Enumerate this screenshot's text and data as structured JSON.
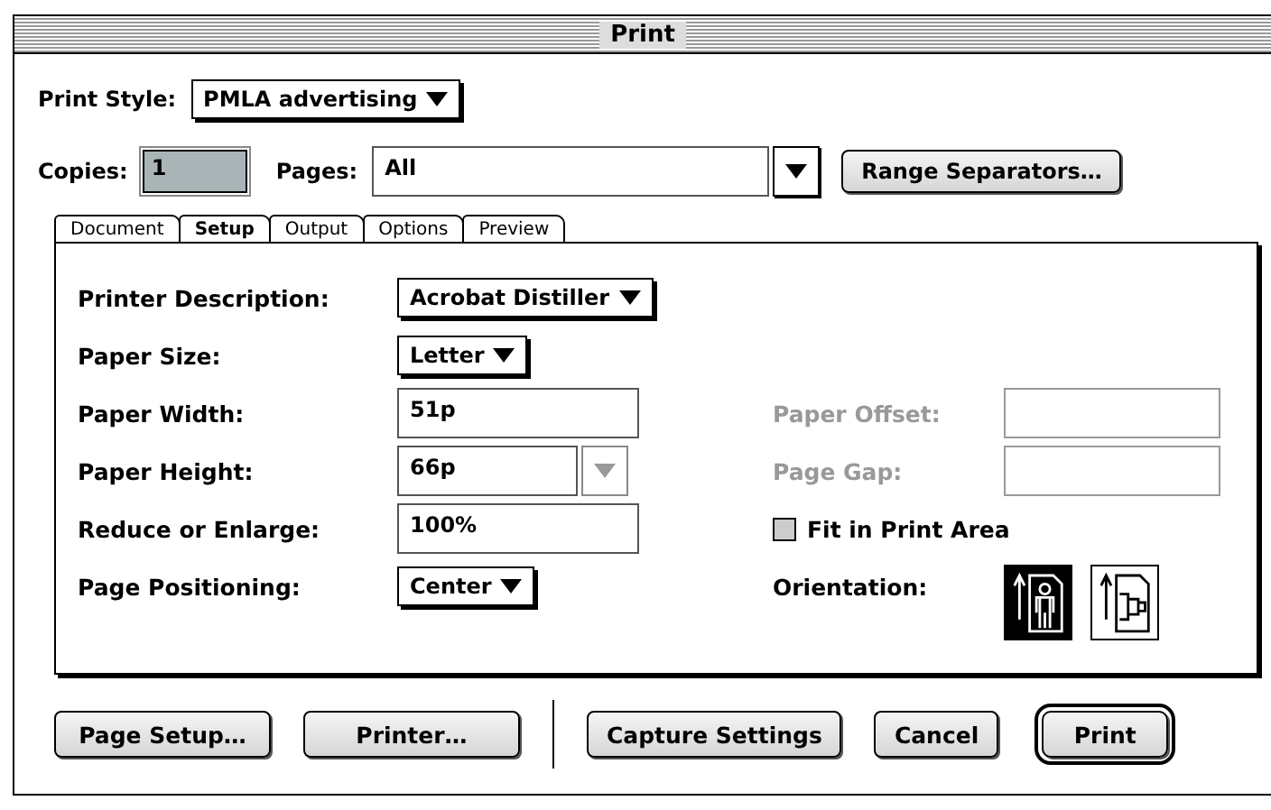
{
  "window": {
    "title": "Print"
  },
  "print_style": {
    "label": "Print Style:",
    "value": "PMLA advertising"
  },
  "copies": {
    "label": "Copies:",
    "value": "1"
  },
  "pages": {
    "label": "Pages:",
    "value": "All"
  },
  "range_button": "Range Separators…",
  "tabs": [
    {
      "label": "Document",
      "selected": false
    },
    {
      "label": "Setup",
      "selected": true
    },
    {
      "label": "Output",
      "selected": false
    },
    {
      "label": "Options",
      "selected": false
    },
    {
      "label": "Preview",
      "selected": false
    }
  ],
  "left_rows": [
    {
      "kind": "popup",
      "label": "Printer Description:",
      "value": "Acrobat Distiller"
    },
    {
      "kind": "popup",
      "label": "Paper Size:",
      "value": "Letter"
    },
    {
      "kind": "field",
      "label": "Paper Width:",
      "value": "51p"
    },
    {
      "kind": "combo",
      "label": "Paper Height:",
      "value": "66p",
      "disabled_arrow": true
    },
    {
      "kind": "field",
      "label": "Reduce or Enlarge:",
      "value": "100%"
    },
    {
      "kind": "popup",
      "label": "Page Positioning:",
      "value": "Center"
    }
  ],
  "right_rows": [
    {
      "kind": "field",
      "label": "Paper Offset:",
      "disabled": true
    },
    {
      "kind": "field",
      "label": "Page Gap:",
      "disabled": true
    },
    {
      "kind": "checkbox",
      "label": "Fit in Print Area",
      "checked": false
    },
    {
      "kind": "orientation",
      "label": "Orientation:",
      "options": [
        {
          "kind": "portrait",
          "selected": true
        },
        {
          "kind": "landscape",
          "selected": false
        }
      ]
    }
  ],
  "buttons_left": [
    {
      "label": "Page Setup…",
      "default": false
    },
    {
      "label": "Printer…",
      "default": false
    }
  ],
  "buttons_right": [
    {
      "label": "Capture Settings",
      "default": false
    },
    {
      "label": "Cancel",
      "default": false
    },
    {
      "label": "Print",
      "default": true
    }
  ]
}
